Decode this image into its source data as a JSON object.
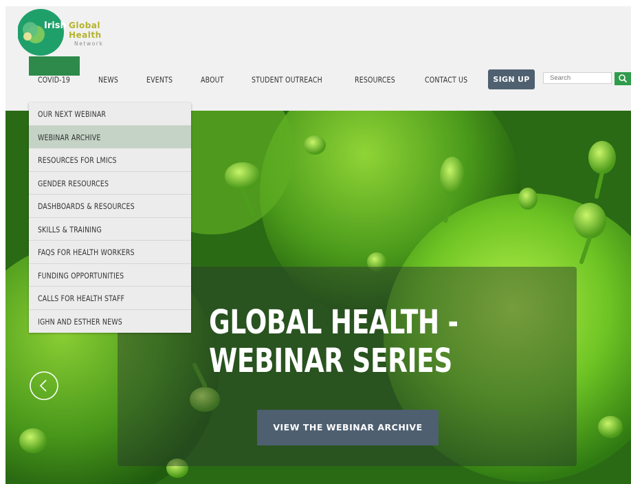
{
  "logo": {
    "line1": "Irish",
    "line2": "Global",
    "line3": "Health",
    "line4": "Network"
  },
  "nav": {
    "items": [
      "COVID-19",
      "NEWS",
      "EVENTS",
      "ABOUT",
      "STUDENT OUTREACH",
      "RESOURCES",
      "CONTACT US"
    ],
    "signup": "SIGN UP",
    "search_placeholder": "Search"
  },
  "dropdown": {
    "items": [
      "OUR NEXT WEBINAR",
      "WEBINAR ARCHIVE",
      "RESOURCES FOR LMICS",
      "GENDER RESOURCES",
      "DASHBOARDS & RESOURCES",
      "SKILLS & TRAINING",
      "FAQS FOR HEALTH WORKERS",
      "FUNDING OPPORTUNITIES",
      "CALLS FOR HEALTH STAFF",
      "IGHN AND ESTHER NEWS"
    ],
    "active_index": 1
  },
  "hero": {
    "title_line1": "GLOBAL HEALTH -",
    "title_line2": "WEBINAR SERIES",
    "cta": "VIEW THE WEBINAR ARCHIVE"
  },
  "icons": {
    "prev": "chevron-left-icon",
    "search": "search-icon"
  },
  "colors": {
    "brand_green": "#2d8a4b",
    "signup_bg": "#4f6070",
    "cta_bg": "#4e5f70",
    "active_item": "#c4d3c6"
  }
}
